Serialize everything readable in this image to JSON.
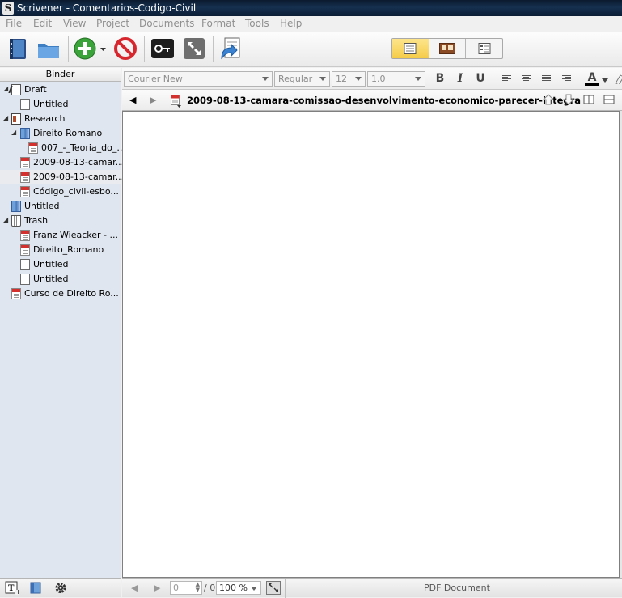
{
  "window": {
    "title": "Scrivener - Comentarios-Codigo-Civil",
    "app_icon": "S"
  },
  "menu": [
    {
      "label": "File",
      "key": "F"
    },
    {
      "label": "Edit",
      "key": "E"
    },
    {
      "label": "View",
      "key": "V"
    },
    {
      "label": "Project",
      "key": "P"
    },
    {
      "label": "Documents",
      "key": "D"
    },
    {
      "label": "Format",
      "key": "o"
    },
    {
      "label": "Tools",
      "key": "T"
    },
    {
      "label": "Help",
      "key": "H"
    }
  ],
  "toolbar": {
    "icons": [
      "binder-book-icon",
      "collections-folder-icon",
      "add-icon",
      "add-menu-arrow-icon",
      "delete-icon",
      "keywords-icon",
      "fullscreen-icon",
      "compile-icon"
    ],
    "view_modes": [
      "scrivenings-icon",
      "corkboard-icon",
      "outliner-icon"
    ],
    "active_view": 0
  },
  "binder": {
    "header": "Binder",
    "items": [
      {
        "label": "Draft",
        "icon": "draft",
        "depth": 0,
        "expand": "open"
      },
      {
        "label": "Untitled",
        "icon": "doc",
        "depth": 1
      },
      {
        "label": "Research",
        "icon": "research",
        "depth": 0,
        "expand": "open"
      },
      {
        "label": "Direito Romano",
        "icon": "folder",
        "depth": 1,
        "expand": "open"
      },
      {
        "label": "007_-_Teoria_do_...",
        "icon": "pdf",
        "depth": 2
      },
      {
        "label": "2009-08-13-camar...",
        "icon": "pdf",
        "depth": 1
      },
      {
        "label": "2009-08-13-camar...",
        "icon": "pdf",
        "depth": 1,
        "selected": true
      },
      {
        "label": "Código_civil-esbo...",
        "icon": "pdf",
        "depth": 1
      },
      {
        "label": "Untitled",
        "icon": "folder",
        "depth": 0
      },
      {
        "label": "Trash",
        "icon": "trash",
        "depth": 0,
        "expand": "open"
      },
      {
        "label": "Franz Wieacker - ...",
        "icon": "pdf",
        "depth": 1
      },
      {
        "label": "Direito_Romano",
        "icon": "pdf",
        "depth": 1
      },
      {
        "label": "Untitled",
        "icon": "doc",
        "depth": 1
      },
      {
        "label": "Untitled",
        "icon": "doc",
        "depth": 1
      },
      {
        "label": "Curso de Direito Ro...",
        "icon": "pdf",
        "depth": 0
      }
    ]
  },
  "format_bar": {
    "font": "Courier New",
    "style": "Regular",
    "size": "12",
    "line_spacing": "1.0",
    "bold": "B",
    "italic": "I",
    "underline": "U",
    "text_color": "A"
  },
  "header_bar": {
    "back": "◀",
    "forward": "▶",
    "document_title": "2009-08-13-camara-comissao-desenvolvimento-economico-parecer-integra"
  },
  "footer": {
    "page": "0",
    "page_total": "/ 0",
    "zoom": "100 %",
    "document_type": "PDF Document"
  }
}
